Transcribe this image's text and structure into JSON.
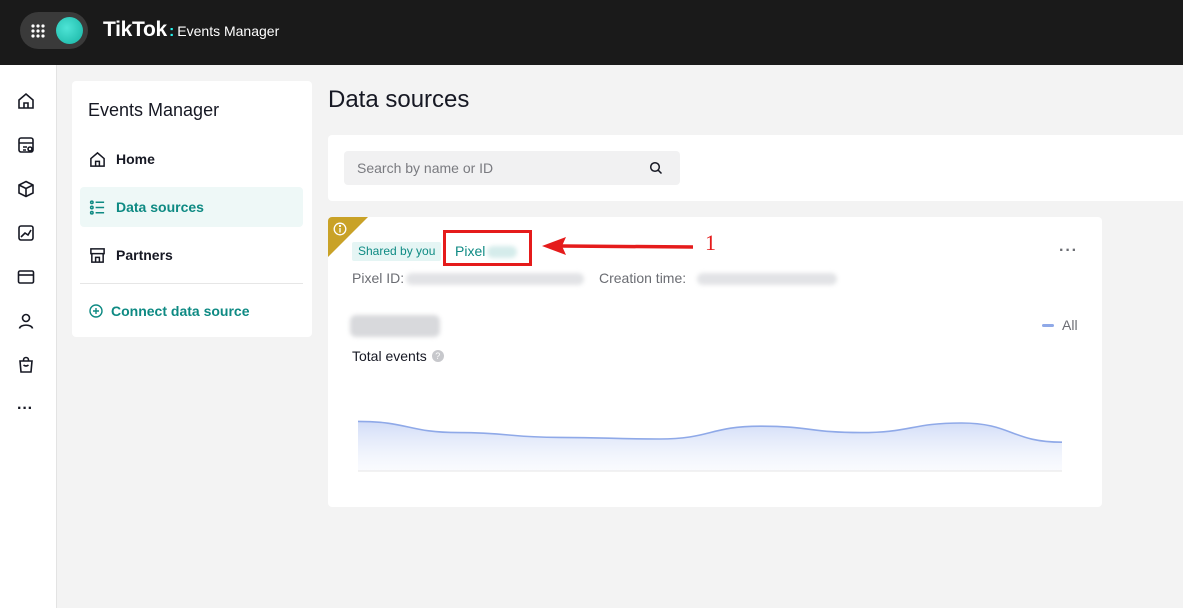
{
  "topbar": {
    "brand_name": "TikTok",
    "brand_separator": ":",
    "product_name": "Events Manager",
    "apps_icon": "grid-icon",
    "accent_color": "#25f4ee"
  },
  "rail": {
    "items": [
      {
        "icon": "home-icon"
      },
      {
        "icon": "catalog-icon"
      },
      {
        "icon": "box-icon"
      },
      {
        "icon": "image-chart-icon"
      },
      {
        "icon": "wallet-icon"
      },
      {
        "icon": "user-icon"
      },
      {
        "icon": "shopping-bag-icon"
      }
    ],
    "more_label": "···"
  },
  "sidebar": {
    "title": "Events Manager",
    "items": [
      {
        "label": "Home",
        "icon": "home-icon",
        "active": false
      },
      {
        "label": "Data sources",
        "icon": "list-icon",
        "active": true
      },
      {
        "label": "Partners",
        "icon": "store-icon",
        "active": false
      }
    ],
    "connect_label": "Connect data source"
  },
  "main": {
    "title": "Data sources",
    "search": {
      "placeholder": "Search by name or ID",
      "value": ""
    }
  },
  "card": {
    "shared_badge": "Shared by you",
    "pixel_name": "Pixel",
    "pixel_id_label": "Pixel ID:",
    "creation_time_label": "Creation time:",
    "legend_label": "All",
    "total_events_label": "Total events",
    "help_label": "?",
    "more_label": "···",
    "accent_color": "#0e8a83",
    "warning_color": "#c9a227"
  },
  "annotation": {
    "number": "1",
    "color": "#e51b1b"
  },
  "chart_data": {
    "type": "area",
    "title": "",
    "xlabel": "",
    "ylabel": "",
    "series": [
      {
        "values": [
          0.62,
          0.48,
          0.42,
          0.4,
          0.56,
          0.48,
          0.6,
          0.36
        ]
      }
    ]
  }
}
